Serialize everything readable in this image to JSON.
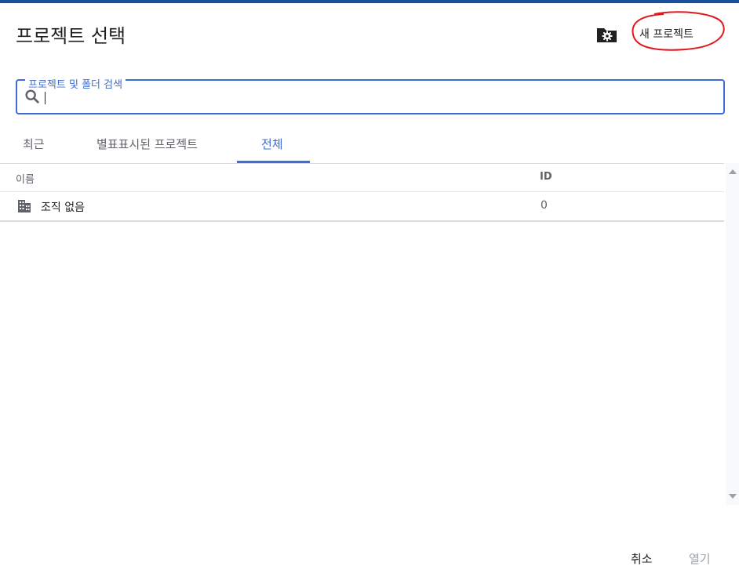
{
  "dialog": {
    "title": "프로젝트 선택",
    "new_project_label": "새 프로젝트"
  },
  "search": {
    "label": "프로젝트 및 폴더 검색",
    "value": ""
  },
  "tabs": [
    {
      "label": "최근",
      "active": false
    },
    {
      "label": "별표표시된 프로젝트",
      "active": false
    },
    {
      "label": "전체",
      "active": true
    }
  ],
  "table": {
    "columns": [
      "이름",
      "ID"
    ],
    "rows": [
      {
        "name": "조직 없음",
        "id": "0",
        "icon": "building-icon"
      }
    ]
  },
  "footer": {
    "cancel_label": "취소",
    "open_label": "열기"
  },
  "colors": {
    "accent": "#3c6dd1",
    "annotation": "#e0191f",
    "disabled_text": "#9aa0a6"
  }
}
